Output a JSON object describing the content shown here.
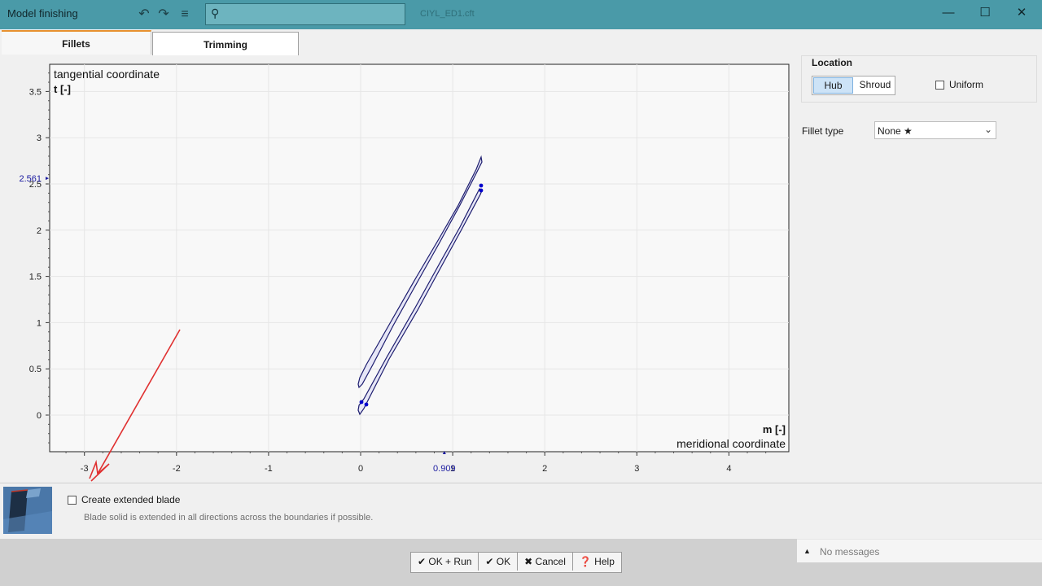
{
  "window": {
    "title": "Model finishing",
    "filename": "CIYL_ED1.cft",
    "search_placeholder": "",
    "buttons": {
      "minimize": "—",
      "maximize": "☐",
      "close": "✕"
    }
  },
  "toolbar": {
    "undo_icon": "↶",
    "redo_icon": "↷",
    "menu_icon": "≡",
    "search_icon": "⚲"
  },
  "tabs": [
    {
      "label": "Fillets",
      "active": true
    },
    {
      "label": "Trimming",
      "active": false
    }
  ],
  "plot": {
    "y_title": "tangential coordinate",
    "y_unit": "t [-]",
    "x_unit": "m [-]",
    "x_title": "meridional coordinate",
    "x_ticks": [
      "-3",
      "-2",
      "-1",
      "0",
      "1",
      "2",
      "3",
      "4"
    ],
    "y_ticks": [
      "0",
      "0.5",
      "1",
      "1.5",
      "2",
      "2.5",
      "3",
      "3.5"
    ],
    "x_marker": "0.909",
    "y_marker": "2.561",
    "x_range": [
      -3.5,
      4.6
    ],
    "y_range": [
      -0.4,
      3.8
    ]
  },
  "location": {
    "label": "Location",
    "hub": "Hub",
    "shroud": "Shroud",
    "uniform": "Uniform",
    "uniform_checked": false
  },
  "fillet": {
    "label": "Fillet type",
    "value": "None ★"
  },
  "extended": {
    "label": "Create extended blade",
    "checked": false,
    "description": "Blade solid is extended in all directions across the boundaries if possible."
  },
  "actions": {
    "ok_run": "✔ OK + Run",
    "ok": "✔ OK",
    "cancel": "✖ Cancel",
    "help": "❓ Help"
  },
  "messages": {
    "text": "No messages",
    "icon": "▲"
  },
  "colors": {
    "titlebar": "#4a9aa8",
    "accent_tab": "#e8912f",
    "blade": "#1c1c6e",
    "arrow": "#e03030"
  }
}
